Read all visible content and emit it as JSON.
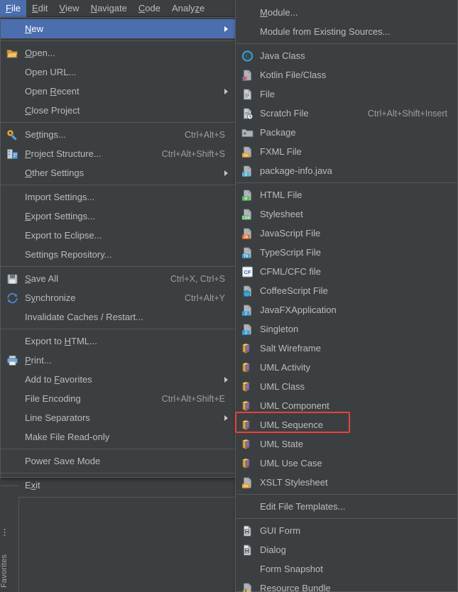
{
  "app": {
    "theme_bg": "#3c3f41",
    "accent": "#4b6eaf",
    "annotation_color": "#e8413c",
    "text_color": "#bbbbbb"
  },
  "menubar": {
    "items": [
      {
        "label": "File",
        "mnemonic": "F",
        "active": true
      },
      {
        "label": "Edit",
        "mnemonic": "E",
        "active": false
      },
      {
        "label": "View",
        "mnemonic": "V",
        "active": false
      },
      {
        "label": "Navigate",
        "mnemonic": "N",
        "active": false
      },
      {
        "label": "Code",
        "mnemonic": "C",
        "active": false
      },
      {
        "label": "Analyze",
        "mnemonic": "z",
        "active": false
      }
    ]
  },
  "file_menu": {
    "items": [
      {
        "label": "New",
        "shortcut": "",
        "icon": "",
        "submenu": true,
        "selected": true
      },
      {
        "separator": true
      },
      {
        "label": "Open...",
        "shortcut": "",
        "icon": "folder-open-icon",
        "submenu": false
      },
      {
        "label": "Open URL...",
        "shortcut": "",
        "icon": "",
        "submenu": false
      },
      {
        "label": "Open Recent",
        "shortcut": "",
        "icon": "",
        "submenu": true
      },
      {
        "label": "Close Project",
        "shortcut": "",
        "icon": "",
        "submenu": false
      },
      {
        "separator": true
      },
      {
        "label": "Settings...",
        "shortcut": "Ctrl+Alt+S",
        "icon": "settings-gear-icon",
        "submenu": false
      },
      {
        "label": "Project Structure...",
        "shortcut": "Ctrl+Alt+Shift+S",
        "icon": "project-structure-icon",
        "submenu": false
      },
      {
        "label": "Other Settings",
        "shortcut": "",
        "icon": "",
        "submenu": true
      },
      {
        "separator": true
      },
      {
        "label": "Import Settings...",
        "shortcut": "",
        "icon": "",
        "submenu": false
      },
      {
        "label": "Export Settings...",
        "shortcut": "",
        "icon": "",
        "submenu": false
      },
      {
        "label": "Export to Eclipse...",
        "shortcut": "",
        "icon": "",
        "submenu": false
      },
      {
        "label": "Settings Repository...",
        "shortcut": "",
        "icon": "",
        "submenu": false
      },
      {
        "separator": true
      },
      {
        "label": "Save All",
        "shortcut": "Ctrl+X, Ctrl+S",
        "icon": "save-all-icon",
        "submenu": false
      },
      {
        "label": "Synchronize",
        "shortcut": "Ctrl+Alt+Y",
        "icon": "synchronize-icon",
        "submenu": false
      },
      {
        "label": "Invalidate Caches / Restart...",
        "shortcut": "",
        "icon": "",
        "submenu": false
      },
      {
        "separator": true
      },
      {
        "label": "Export to HTML...",
        "shortcut": "",
        "icon": "",
        "submenu": false
      },
      {
        "label": "Print...",
        "shortcut": "",
        "icon": "print-icon",
        "submenu": false
      },
      {
        "label": "Add to Favorites",
        "shortcut": "",
        "icon": "",
        "submenu": true
      },
      {
        "label": "File Encoding",
        "shortcut": "Ctrl+Alt+Shift+E",
        "icon": "",
        "submenu": false
      },
      {
        "label": "Line Separators",
        "shortcut": "",
        "icon": "",
        "submenu": true
      },
      {
        "label": "Make File Read-only",
        "shortcut": "",
        "icon": "",
        "submenu": false
      },
      {
        "separator": true
      },
      {
        "label": "Power Save Mode",
        "shortcut": "",
        "icon": "",
        "submenu": false
      },
      {
        "separator": true
      },
      {
        "label": "Exit",
        "shortcut": "",
        "icon": "",
        "submenu": false
      }
    ]
  },
  "new_submenu": {
    "items": [
      {
        "label": "Module...",
        "shortcut": "",
        "icon": "",
        "highlighted": false
      },
      {
        "label": "Module from Existing Sources...",
        "shortcut": "",
        "icon": "",
        "highlighted": false
      },
      {
        "separator": true
      },
      {
        "label": "Java Class",
        "shortcut": "",
        "icon": "java-class-icon",
        "highlighted": false
      },
      {
        "label": "Kotlin File/Class",
        "shortcut": "",
        "icon": "kotlin-file-icon",
        "highlighted": false
      },
      {
        "label": "File",
        "shortcut": "",
        "icon": "file-icon",
        "highlighted": false
      },
      {
        "label": "Scratch File",
        "shortcut": "Ctrl+Alt+Shift+Insert",
        "icon": "scratch-file-icon",
        "highlighted": false
      },
      {
        "label": "Package",
        "shortcut": "",
        "icon": "package-icon",
        "highlighted": false
      },
      {
        "label": "FXML File",
        "shortcut": "",
        "icon": "fxml-file-icon",
        "highlighted": false
      },
      {
        "label": "package-info.java",
        "shortcut": "",
        "icon": "package-info-icon",
        "highlighted": false
      },
      {
        "separator": true
      },
      {
        "label": "HTML File",
        "shortcut": "",
        "icon": "html-file-icon",
        "highlighted": false
      },
      {
        "label": "Stylesheet",
        "shortcut": "",
        "icon": "css-file-icon",
        "highlighted": false
      },
      {
        "label": "JavaScript File",
        "shortcut": "",
        "icon": "javascript-file-icon",
        "highlighted": false
      },
      {
        "label": "TypeScript File",
        "shortcut": "",
        "icon": "typescript-file-icon",
        "highlighted": false
      },
      {
        "label": "CFML/CFC file",
        "shortcut": "",
        "icon": "cfml-file-icon",
        "highlighted": false
      },
      {
        "label": "CoffeeScript File",
        "shortcut": "",
        "icon": "coffeescript-file-icon",
        "highlighted": false
      },
      {
        "label": "JavaFXApplication",
        "shortcut": "",
        "icon": "javafx-application-icon",
        "highlighted": false
      },
      {
        "label": "Singleton",
        "shortcut": "",
        "icon": "singleton-icon",
        "highlighted": false
      },
      {
        "label": "Salt Wireframe",
        "shortcut": "",
        "icon": "uml-diagram-icon",
        "highlighted": false
      },
      {
        "label": "UML Activity",
        "shortcut": "",
        "icon": "uml-diagram-icon",
        "highlighted": false
      },
      {
        "label": "UML Class",
        "shortcut": "",
        "icon": "uml-diagram-icon",
        "highlighted": false
      },
      {
        "label": "UML Component",
        "shortcut": "",
        "icon": "uml-diagram-icon",
        "highlighted": false
      },
      {
        "label": "UML Sequence",
        "shortcut": "",
        "icon": "uml-diagram-icon",
        "highlighted": true
      },
      {
        "label": "UML State",
        "shortcut": "",
        "icon": "uml-diagram-icon",
        "highlighted": false
      },
      {
        "label": "UML Use Case",
        "shortcut": "",
        "icon": "uml-diagram-icon",
        "highlighted": false
      },
      {
        "label": "XSLT Stylesheet",
        "shortcut": "",
        "icon": "xslt-stylesheet-icon",
        "highlighted": false
      },
      {
        "separator": true
      },
      {
        "label": "Edit File Templates...",
        "shortcut": "",
        "icon": "",
        "highlighted": false
      },
      {
        "separator": true
      },
      {
        "label": "GUI Form",
        "shortcut": "",
        "icon": "gui-form-icon",
        "highlighted": false
      },
      {
        "label": "Dialog",
        "shortcut": "",
        "icon": "dialog-icon",
        "highlighted": false
      },
      {
        "label": "Form Snapshot",
        "shortcut": "",
        "icon": "",
        "highlighted": false
      },
      {
        "label": "Resource Bundle",
        "shortcut": "",
        "icon": "resource-bundle-icon",
        "highlighted": false
      }
    ]
  },
  "sidebar": {
    "favorites_label": "Favorites"
  }
}
